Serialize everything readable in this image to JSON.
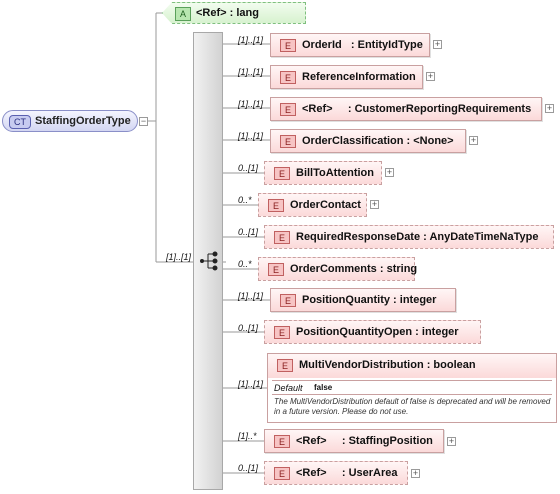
{
  "complex_type": {
    "badge": "CT",
    "name": "StaffingOrderType"
  },
  "attribute": {
    "badge": "A",
    "label": "<Ref>     : lang"
  },
  "sequence": {
    "multiplicity": "[1]..[1]"
  },
  "elements": [
    {
      "badge": "E",
      "label": "OrderId   : EntityIdType",
      "multiplicity": "[1]..[1]",
      "required": true,
      "expandable": true
    },
    {
      "badge": "E",
      "label": "ReferenceInformation",
      "multiplicity": "[1]..[1]",
      "required": true,
      "expandable": true
    },
    {
      "badge": "E",
      "label": "<Ref>     : CustomerReportingRequirements",
      "multiplicity": "[1]..[1]",
      "required": true,
      "expandable": true
    },
    {
      "badge": "E",
      "label": "OrderClassification : <None>",
      "multiplicity": "[1]..[1]",
      "required": true,
      "expandable": true
    },
    {
      "badge": "E",
      "label": "BillToAttention",
      "multiplicity": "0..[1]",
      "required": false,
      "expandable": true
    },
    {
      "badge": "E",
      "label": "OrderContact",
      "multiplicity": "0..*",
      "required": false,
      "expandable": true
    },
    {
      "badge": "E",
      "label": "RequiredResponseDate : AnyDateTimeNaType",
      "multiplicity": "0..[1]",
      "required": false,
      "expandable": false
    },
    {
      "badge": "E",
      "label": "OrderComments : string",
      "multiplicity": "0..*",
      "required": false,
      "expandable": false
    },
    {
      "badge": "E",
      "label": "PositionQuantity : integer",
      "multiplicity": "[1]..[1]",
      "required": true,
      "expandable": false
    },
    {
      "badge": "E",
      "label": "PositionQuantityOpen : integer",
      "multiplicity": "0..[1]",
      "required": false,
      "expandable": false
    },
    {
      "badge": "E",
      "label": "MultiVendorDistribution : boolean",
      "multiplicity": "[1]..[1]",
      "required": true,
      "expandable": false,
      "default_label": "Default",
      "default_value": "false",
      "documentation": "The MultiVendorDistribution default of false is deprecated and will be removed in a future version. Please do not use."
    },
    {
      "badge": "E",
      "label": "<Ref>     : StaffingPosition",
      "multiplicity": "[1]..*",
      "required": true,
      "expandable": true
    },
    {
      "badge": "E",
      "label": "<Ref>     : UserArea",
      "multiplicity": "0..[1]",
      "required": false,
      "expandable": true
    }
  ],
  "colors": {
    "element_fill": "#fbd9d9",
    "element_border": "#c9a0a0",
    "attribute_fill": "#d7f2cf",
    "complex_type_fill": "#d3d6f2"
  },
  "icons": {
    "collapse": "minus-box-icon",
    "expand": "plus-box-icon",
    "sequence": "sequence-compositor-icon"
  }
}
